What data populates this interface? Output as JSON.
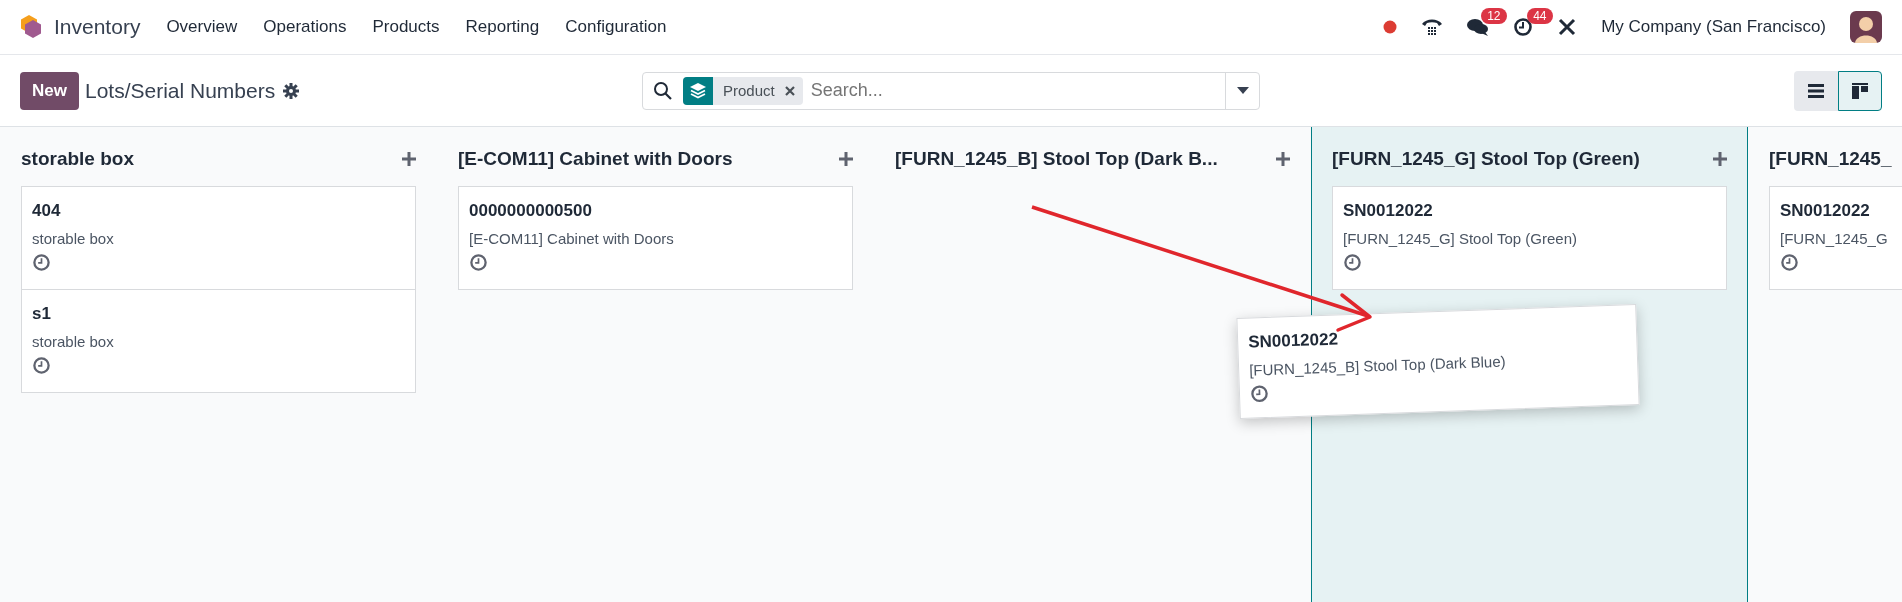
{
  "navbar": {
    "app_name": "Inventory",
    "menu": [
      "Overview",
      "Operations",
      "Products",
      "Reporting",
      "Configuration"
    ],
    "messages_badge": "12",
    "activities_badge": "44",
    "company": "My Company (San Francisco)"
  },
  "control_panel": {
    "new_button": "New",
    "title": "Lots/Serial Numbers",
    "search": {
      "facet": "Product",
      "placeholder": "Search..."
    },
    "views": [
      {
        "kind": "list",
        "selected": false
      },
      {
        "kind": "kanban",
        "selected": true
      }
    ]
  },
  "columns": [
    {
      "title": "storable box",
      "highlighted": false,
      "cards": [
        {
          "name": "404",
          "product": "storable box"
        },
        {
          "name": "s1",
          "product": "storable box"
        }
      ]
    },
    {
      "title": "[E-COM11] Cabinet with Doors",
      "highlighted": false,
      "cards": [
        {
          "name": "0000000000500",
          "product": "[E-COM11] Cabinet with Doors"
        }
      ]
    },
    {
      "title": "[FURN_1245_B] Stool Top (Dark B...",
      "highlighted": false
    },
    {
      "title": "[FURN_1245_G] Stool Top (Green)",
      "highlighted": true,
      "cards": [
        {
          "name": "SN0012022",
          "product": "[FURN_1245_G] Stool Top (Green)"
        }
      ]
    },
    {
      "title": "[FURN_1245_",
      "highlighted": false,
      "cards": [
        {
          "name": "SN0012022",
          "product": "[FURN_1245_G"
        }
      ]
    }
  ],
  "dragged_card": {
    "name": "SN0012022",
    "product": "[FURN_1245_B] Stool Top (Dark Blue)"
  }
}
